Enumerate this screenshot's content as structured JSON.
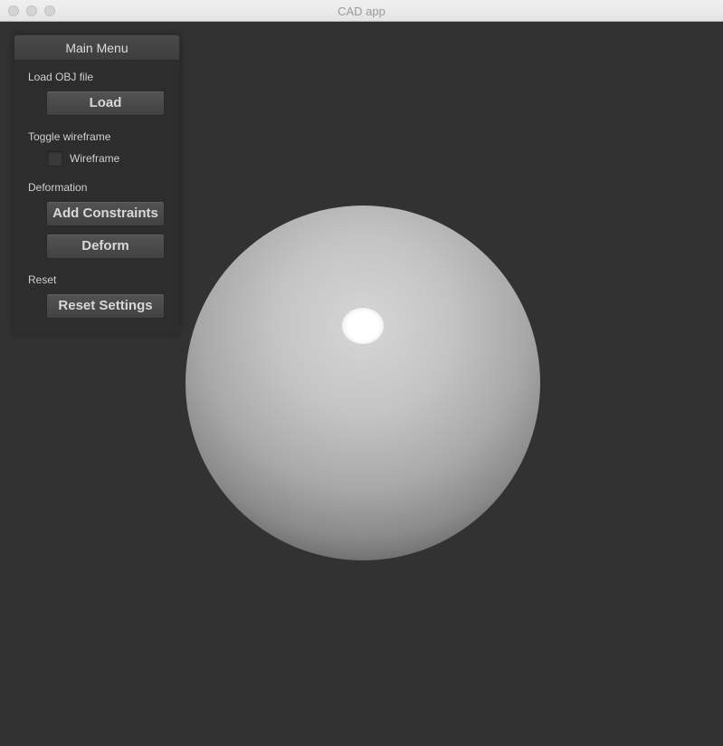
{
  "window": {
    "title": "CAD app"
  },
  "panel": {
    "header": "Main Menu",
    "sections": {
      "load": {
        "label": "Load OBJ file",
        "button": "Load"
      },
      "wireframe": {
        "label": "Toggle wireframe",
        "checkbox_label": "Wireframe",
        "checked": false
      },
      "deformation": {
        "label": "Deformation",
        "add_constraints_button": "Add Constraints",
        "deform_button": "Deform"
      },
      "reset": {
        "label": "Reset",
        "button": "Reset Settings"
      }
    }
  },
  "viewport": {
    "object": "sphere-icon"
  },
  "colors": {
    "background": "#323232",
    "panel": "#2d2d2d",
    "button": "#4a4a4a",
    "text": "#d0d0d0"
  }
}
